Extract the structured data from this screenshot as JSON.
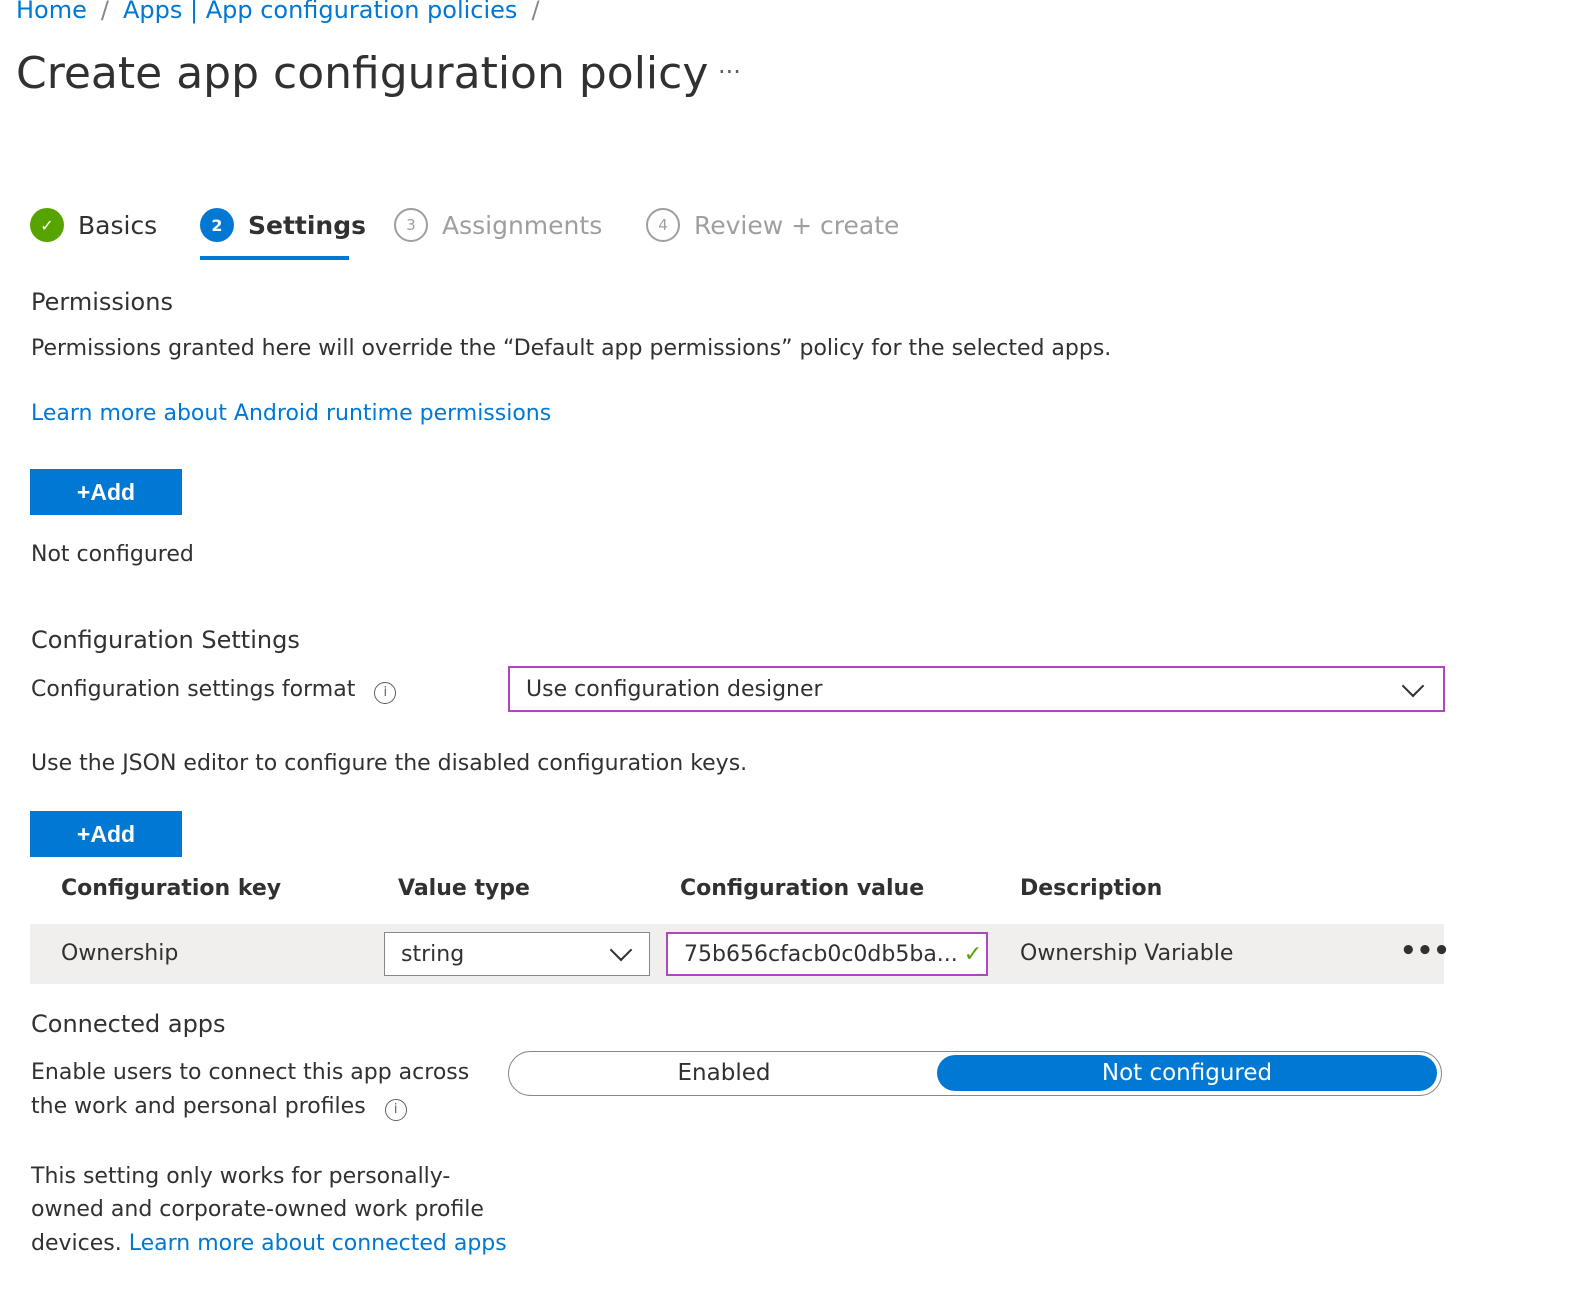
{
  "breadcrumb": [
    "Home",
    "Apps | App configuration policies"
  ],
  "title": "Create app configuration policy",
  "more": "···",
  "steps": [
    {
      "num": "✓",
      "label": "Basics",
      "state": "done"
    },
    {
      "num": "2",
      "label": "Settings",
      "state": "current"
    },
    {
      "num": "3",
      "label": "Assignments",
      "state": "future"
    },
    {
      "num": "4",
      "label": "Review + create",
      "state": "future"
    }
  ],
  "permissions": {
    "heading": "Permissions",
    "description": "Permissions granted here will override the “Default app permissions” policy for the selected apps.",
    "link": "Learn more about Android runtime permissions",
    "add": "+Add",
    "status": "Not configured"
  },
  "config": {
    "heading": "Configuration Settings",
    "format_label": "Configuration settings format",
    "format_value": "Use configuration designer",
    "json_note": "Use the JSON editor to configure the disabled configuration keys.",
    "add": "+Add",
    "columns": [
      "Configuration key",
      "Value type",
      "Configuration value",
      "Description"
    ],
    "rows": [
      {
        "key": "Ownership",
        "type": "string",
        "value": "75b656cfacb0c0db5ba...",
        "description": "Ownership Variable"
      }
    ]
  },
  "connected": {
    "heading": "Connected apps",
    "label_line1": "Enable users to connect this app across",
    "label_line2": "the work and personal profiles",
    "options": [
      "Enabled",
      "Not configured"
    ],
    "selected": "Not configured",
    "note_line1": "This setting only works for personally-",
    "note_line2": "owned and corporate-owned work profile",
    "note_prefix": "devices. ",
    "note_link": "Learn more about connected apps"
  },
  "colors": {
    "accent": "#0078d4",
    "success": "#57a300",
    "focus_border": "#b146c2"
  }
}
